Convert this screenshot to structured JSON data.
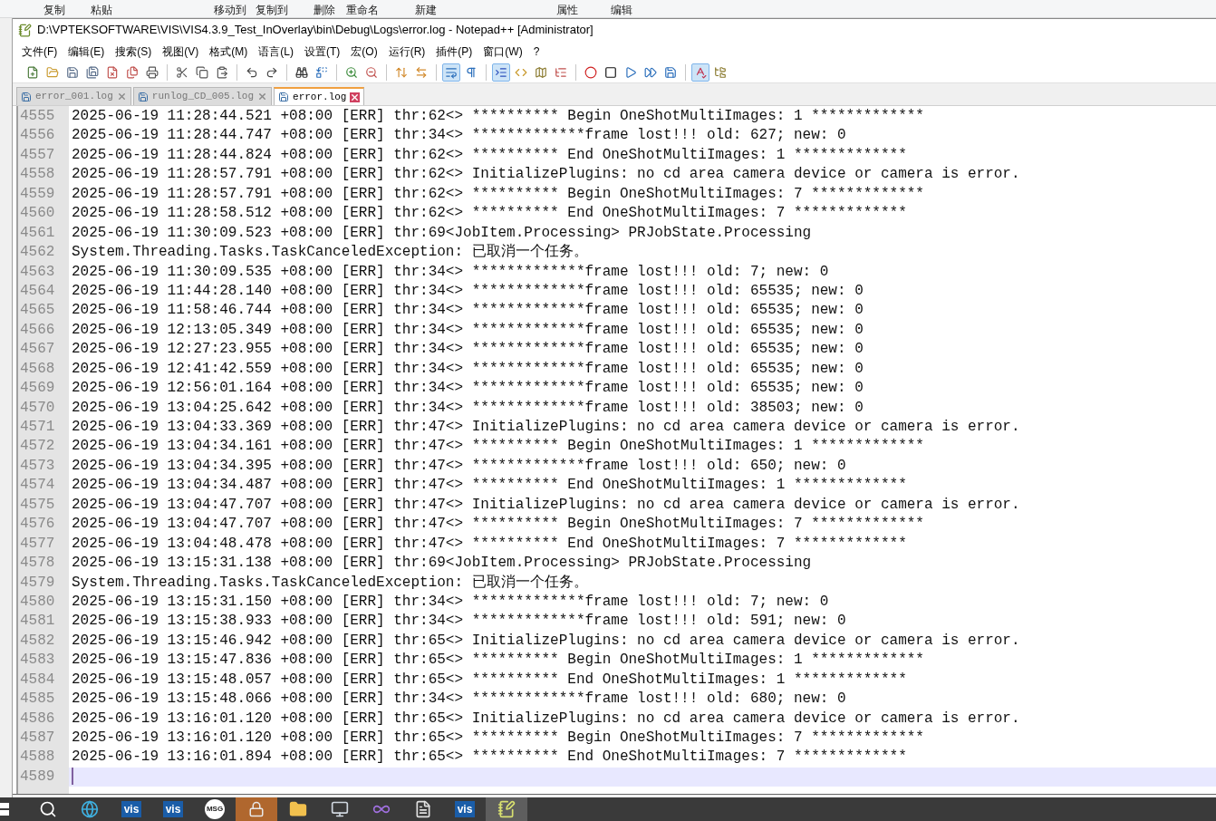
{
  "background_ribbon": {
    "items": [
      "复制",
      "粘贴",
      "移动到",
      "复制到",
      "删除",
      "重命名",
      "新建",
      "属性",
      "编辑"
    ]
  },
  "window": {
    "title": "D:\\VPTEKSOFTWARE\\VIS\\VIS4.3.9_Test_InOverlay\\bin\\Debug\\Logs\\error.log - Notepad++ [Administrator]"
  },
  "menu": [
    "文件(F)",
    "编辑(E)",
    "搜索(S)",
    "视图(V)",
    "格式(M)",
    "语言(L)",
    "设置(T)",
    "宏(O)",
    "运行(R)",
    "插件(P)",
    "窗口(W)",
    "?"
  ],
  "toolbar": [
    {
      "kind": "new",
      "pressed": false
    },
    {
      "kind": "open",
      "pressed": false
    },
    {
      "kind": "save",
      "pressed": false
    },
    {
      "kind": "save-all",
      "pressed": false
    },
    {
      "kind": "close",
      "pressed": false
    },
    {
      "kind": "close-all",
      "pressed": false
    },
    {
      "kind": "print",
      "pressed": false
    },
    {
      "kind": "separator"
    },
    {
      "kind": "cut",
      "pressed": false
    },
    {
      "kind": "copy",
      "pressed": false
    },
    {
      "kind": "paste",
      "pressed": false
    },
    {
      "kind": "separator"
    },
    {
      "kind": "undo",
      "pressed": false
    },
    {
      "kind": "redo",
      "pressed": false
    },
    {
      "kind": "separator"
    },
    {
      "kind": "find",
      "pressed": false
    },
    {
      "kind": "replace",
      "pressed": false
    },
    {
      "kind": "separator"
    },
    {
      "kind": "zoom-in",
      "pressed": false
    },
    {
      "kind": "zoom-out",
      "pressed": false
    },
    {
      "kind": "separator"
    },
    {
      "kind": "sync-vertical",
      "pressed": false
    },
    {
      "kind": "sync-horizontal",
      "pressed": false
    },
    {
      "kind": "separator"
    },
    {
      "kind": "word-wrap",
      "pressed": true
    },
    {
      "kind": "all-chars",
      "pressed": false
    },
    {
      "kind": "separator"
    },
    {
      "kind": "indent-guide",
      "pressed": true
    },
    {
      "kind": "language",
      "pressed": false
    },
    {
      "kind": "document-map",
      "pressed": false
    },
    {
      "kind": "function-list",
      "pressed": false
    },
    {
      "kind": "separator"
    },
    {
      "kind": "record",
      "pressed": false
    },
    {
      "kind": "stop",
      "pressed": false
    },
    {
      "kind": "play",
      "pressed": false
    },
    {
      "kind": "play-multiple",
      "pressed": false
    },
    {
      "kind": "save-macro",
      "pressed": false
    },
    {
      "kind": "separator"
    },
    {
      "kind": "spell-check",
      "pressed": true
    },
    {
      "kind": "folder-view",
      "pressed": false
    }
  ],
  "tabs": [
    {
      "label": "error_001.log",
      "selected": false
    },
    {
      "label": "runlog_CD_005.log",
      "selected": false
    },
    {
      "label": "error.log",
      "selected": true
    }
  ],
  "editor": {
    "lines": [
      {
        "number": "4555",
        "text": "2025-06-19 11:28:44.521 +08:00 [ERR] thr:62<> ********** Begin OneShotMultiImages: 1 *************",
        "current": false
      },
      {
        "number": "4556",
        "text": "2025-06-19 11:28:44.747 +08:00 [ERR] thr:34<> *************frame lost!!! old: 627; new: 0",
        "current": false
      },
      {
        "number": "4557",
        "text": "2025-06-19 11:28:44.824 +08:00 [ERR] thr:62<> ********** End OneShotMultiImages: 1 *************",
        "current": false
      },
      {
        "number": "4558",
        "text": "2025-06-19 11:28:57.791 +08:00 [ERR] thr:62<> InitializePlugins: no cd area camera device or camera is error.",
        "current": false
      },
      {
        "number": "4559",
        "text": "2025-06-19 11:28:57.791 +08:00 [ERR] thr:62<> ********** Begin OneShotMultiImages: 7 *************",
        "current": false
      },
      {
        "number": "4560",
        "text": "2025-06-19 11:28:58.512 +08:00 [ERR] thr:62<> ********** End OneShotMultiImages: 7 *************",
        "current": false
      },
      {
        "number": "4561",
        "text": "2025-06-19 11:30:09.523 +08:00 [ERR] thr:69<JobItem.Processing> PRJobState.Processing",
        "current": false
      },
      {
        "number": "4562",
        "text": "System.Threading.Tasks.TaskCanceledException: 已取消一个任务。",
        "current": false
      },
      {
        "number": "4563",
        "text": "2025-06-19 11:30:09.535 +08:00 [ERR] thr:34<> *************frame lost!!! old: 7; new: 0",
        "current": false
      },
      {
        "number": "4564",
        "text": "2025-06-19 11:44:28.140 +08:00 [ERR] thr:34<> *************frame lost!!! old: 65535; new: 0",
        "current": false
      },
      {
        "number": "4565",
        "text": "2025-06-19 11:58:46.744 +08:00 [ERR] thr:34<> *************frame lost!!! old: 65535; new: 0",
        "current": false
      },
      {
        "number": "4566",
        "text": "2025-06-19 12:13:05.349 +08:00 [ERR] thr:34<> *************frame lost!!! old: 65535; new: 0",
        "current": false
      },
      {
        "number": "4567",
        "text": "2025-06-19 12:27:23.955 +08:00 [ERR] thr:34<> *************frame lost!!! old: 65535; new: 0",
        "current": false
      },
      {
        "number": "4568",
        "text": "2025-06-19 12:41:42.559 +08:00 [ERR] thr:34<> *************frame lost!!! old: 65535; new: 0",
        "current": false
      },
      {
        "number": "4569",
        "text": "2025-06-19 12:56:01.164 +08:00 [ERR] thr:34<> *************frame lost!!! old: 65535; new: 0",
        "current": false
      },
      {
        "number": "4570",
        "text": "2025-06-19 13:04:25.642 +08:00 [ERR] thr:34<> *************frame lost!!! old: 38503; new: 0",
        "current": false
      },
      {
        "number": "4571",
        "text": "2025-06-19 13:04:33.369 +08:00 [ERR] thr:47<> InitializePlugins: no cd area camera device or camera is error.",
        "current": false
      },
      {
        "number": "4572",
        "text": "2025-06-19 13:04:34.161 +08:00 [ERR] thr:47<> ********** Begin OneShotMultiImages: 1 *************",
        "current": false
      },
      {
        "number": "4573",
        "text": "2025-06-19 13:04:34.395 +08:00 [ERR] thr:47<> *************frame lost!!! old: 650; new: 0",
        "current": false
      },
      {
        "number": "4574",
        "text": "2025-06-19 13:04:34.487 +08:00 [ERR] thr:47<> ********** End OneShotMultiImages: 1 *************",
        "current": false
      },
      {
        "number": "4575",
        "text": "2025-06-19 13:04:47.707 +08:00 [ERR] thr:47<> InitializePlugins: no cd area camera device or camera is error.",
        "current": false
      },
      {
        "number": "4576",
        "text": "2025-06-19 13:04:47.707 +08:00 [ERR] thr:47<> ********** Begin OneShotMultiImages: 7 *************",
        "current": false
      },
      {
        "number": "4577",
        "text": "2025-06-19 13:04:48.478 +08:00 [ERR] thr:47<> ********** End OneShotMultiImages: 7 *************",
        "current": false
      },
      {
        "number": "4578",
        "text": "2025-06-19 13:15:31.138 +08:00 [ERR] thr:69<JobItem.Processing> PRJobState.Processing",
        "current": false
      },
      {
        "number": "4579",
        "text": "System.Threading.Tasks.TaskCanceledException: 已取消一个任务。",
        "current": false
      },
      {
        "number": "4580",
        "text": "2025-06-19 13:15:31.150 +08:00 [ERR] thr:34<> *************frame lost!!! old: 7; new: 0",
        "current": false
      },
      {
        "number": "4581",
        "text": "2025-06-19 13:15:38.933 +08:00 [ERR] thr:34<> *************frame lost!!! old: 591; new: 0",
        "current": false
      },
      {
        "number": "4582",
        "text": "2025-06-19 13:15:46.942 +08:00 [ERR] thr:65<> InitializePlugins: no cd area camera device or camera is error.",
        "current": false
      },
      {
        "number": "4583",
        "text": "2025-06-19 13:15:47.836 +08:00 [ERR] thr:65<> ********** Begin OneShotMultiImages: 1 *************",
        "current": false
      },
      {
        "number": "4584",
        "text": "2025-06-19 13:15:48.057 +08:00 [ERR] thr:65<> ********** End OneShotMultiImages: 1 *************",
        "current": false
      },
      {
        "number": "4585",
        "text": "2025-06-19 13:15:48.066 +08:00 [ERR] thr:34<> *************frame lost!!! old: 680; new: 0",
        "current": false
      },
      {
        "number": "4586",
        "text": "2025-06-19 13:16:01.120 +08:00 [ERR] thr:65<> InitializePlugins: no cd area camera device or camera is error.",
        "current": false
      },
      {
        "number": "4587",
        "text": "2025-06-19 13:16:01.120 +08:00 [ERR] thr:65<> ********** Begin OneShotMultiImages: 7 *************",
        "current": false
      },
      {
        "number": "4588",
        "text": "2025-06-19 13:16:01.894 +08:00 [ERR] thr:65<> ********** End OneShotMultiImages: 7 *************",
        "current": false
      },
      {
        "number": "4589",
        "current": true
      }
    ]
  },
  "taskbar": [
    {
      "kind": "search",
      "selected": false
    },
    {
      "kind": "browser",
      "selected": false
    },
    {
      "kind": "app",
      "label": "vis",
      "selected": false
    },
    {
      "kind": "app",
      "label": "vis",
      "selected": false
    },
    {
      "kind": "badge",
      "label": "MSG",
      "selected": false
    },
    {
      "kind": "lock",
      "selected": false
    },
    {
      "kind": "folder",
      "selected": false
    },
    {
      "kind": "monitor",
      "selected": false
    },
    {
      "kind": "studio",
      "selected": false
    },
    {
      "kind": "document",
      "selected": false
    },
    {
      "kind": "app",
      "label": "vis",
      "selected": false
    },
    {
      "kind": "notepad",
      "selected": true
    }
  ]
}
